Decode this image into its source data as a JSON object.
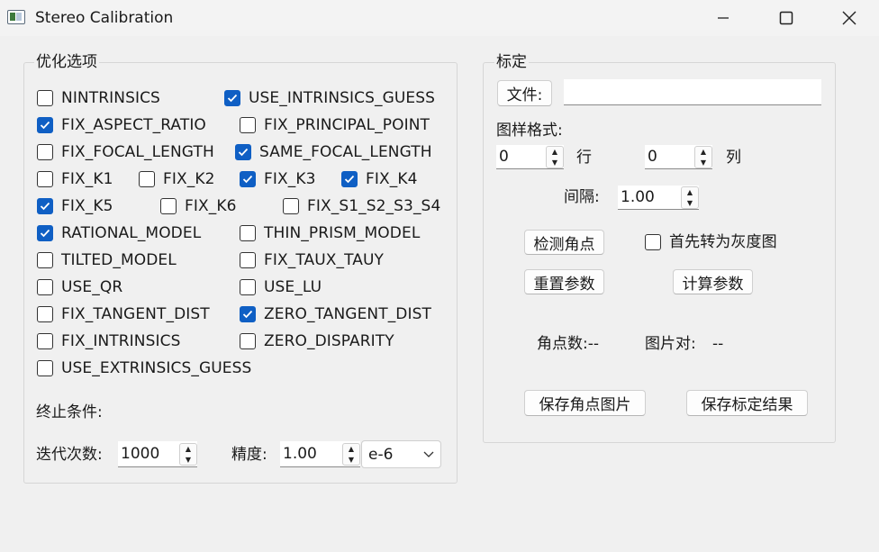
{
  "window": {
    "title": "Stereo Calibration",
    "minimize": "—",
    "maximize": "☐",
    "close": "✕"
  },
  "optimize": {
    "title": "优化选项",
    "options": [
      {
        "label": "NINTRINSICS",
        "checked": false
      },
      {
        "label": "USE_INTRINSICS_GUESS",
        "checked": true
      },
      {
        "label": "FIX_ASPECT_RATIO",
        "checked": true
      },
      {
        "label": "FIX_PRINCIPAL_POINT",
        "checked": false
      },
      {
        "label": "FIX_FOCAL_LENGTH",
        "checked": false
      },
      {
        "label": "SAME_FOCAL_LENGTH",
        "checked": true
      },
      {
        "label": "FIX_K1",
        "checked": false
      },
      {
        "label": "FIX_K2",
        "checked": false
      },
      {
        "label": "FIX_K3",
        "checked": true
      },
      {
        "label": "FIX_K4",
        "checked": true
      },
      {
        "label": "FIX_K5",
        "checked": true
      },
      {
        "label": "FIX_K6",
        "checked": false
      },
      {
        "label": "FIX_S1_S2_S3_S4",
        "checked": false
      },
      {
        "label": "RATIONAL_MODEL",
        "checked": true
      },
      {
        "label": "THIN_PRISM_MODEL",
        "checked": false
      },
      {
        "label": "TILTED_MODEL",
        "checked": false
      },
      {
        "label": "FIX_TAUX_TAUY",
        "checked": false
      },
      {
        "label": "USE_QR",
        "checked": false
      },
      {
        "label": "USE_LU",
        "checked": false
      },
      {
        "label": "FIX_TANGENT_DIST",
        "checked": false
      },
      {
        "label": "ZERO_TANGENT_DIST",
        "checked": true
      },
      {
        "label": "FIX_INTRINSICS",
        "checked": false
      },
      {
        "label": "ZERO_DISPARITY",
        "checked": false
      },
      {
        "label": "USE_EXTRINSICS_GUESS",
        "checked": false
      }
    ],
    "termination_label": "终止条件:",
    "iterations_label": "迭代次数:",
    "iterations_value": "1000",
    "precision_label": "精度:",
    "precision_value": "1.00",
    "precision_exp": "e-6"
  },
  "calib": {
    "title": "标定",
    "file_button": "文件:",
    "file_path": "",
    "pattern_label": "图样格式:",
    "rows_value": "0",
    "rows_label": "行",
    "cols_value": "0",
    "cols_label": "列",
    "spacing_label": "间隔:",
    "spacing_value": "1.00",
    "detect_button": "检测角点",
    "grayscale_label": "首先转为灰度图",
    "grayscale_checked": false,
    "reset_button": "重置参数",
    "compute_button": "计算参数",
    "corners_label": "角点数:--",
    "pairs_label": "图片对:",
    "pairs_value": "--",
    "save_corners_button": "保存角点图片",
    "save_result_button": "保存标定结果"
  }
}
